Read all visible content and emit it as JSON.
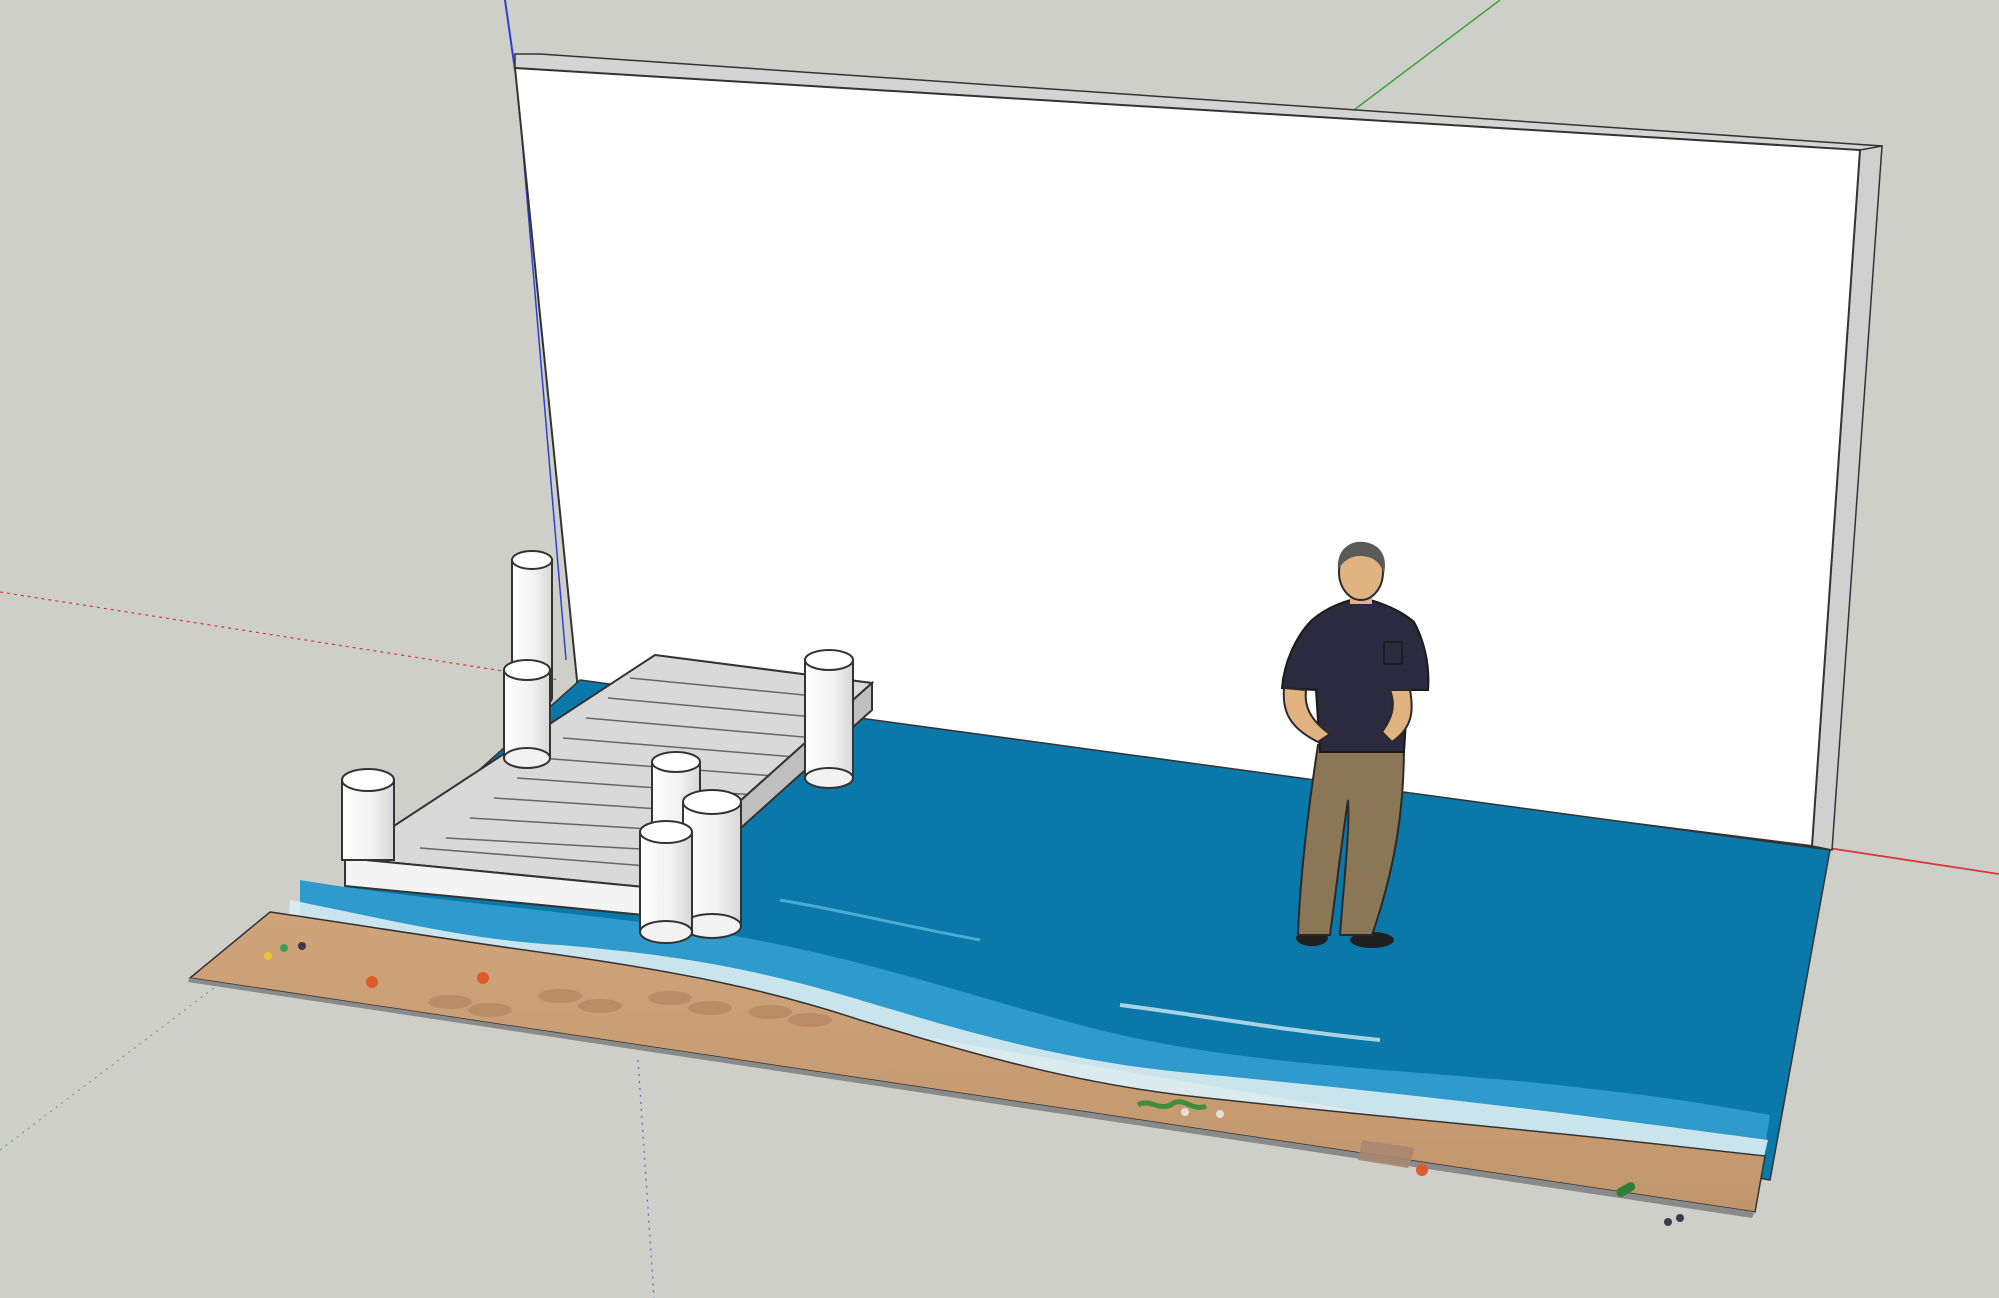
{
  "app": {
    "kind": "3d-modeling-viewport",
    "background_color": "#cfcfca"
  },
  "axes": {
    "red_color": "#d63a3a",
    "green_color": "#3aa53a",
    "blue_color": "#2f3fd0"
  },
  "scene": {
    "backdrop_color": "#ffffff",
    "water_color": "#0a78a8",
    "water_light_color": "#3fa7d2",
    "foam_color": "#dcecf2",
    "sand_color": "#c89e77",
    "sand_dark_color": "#b98a64",
    "dock_color": "#d9d9d9",
    "piling_color": "#f2f2f2",
    "person": {
      "shirt_color": "#2b2a3f",
      "pants_color": "#8b7655",
      "skin_color": "#e0b380",
      "hair_color": "#5a5a5a"
    },
    "icons": [
      "dock-icon",
      "piling-icon",
      "person-icon",
      "bottle-icon",
      "crab-icon",
      "seaweed-icon",
      "footprint-icon"
    ]
  }
}
